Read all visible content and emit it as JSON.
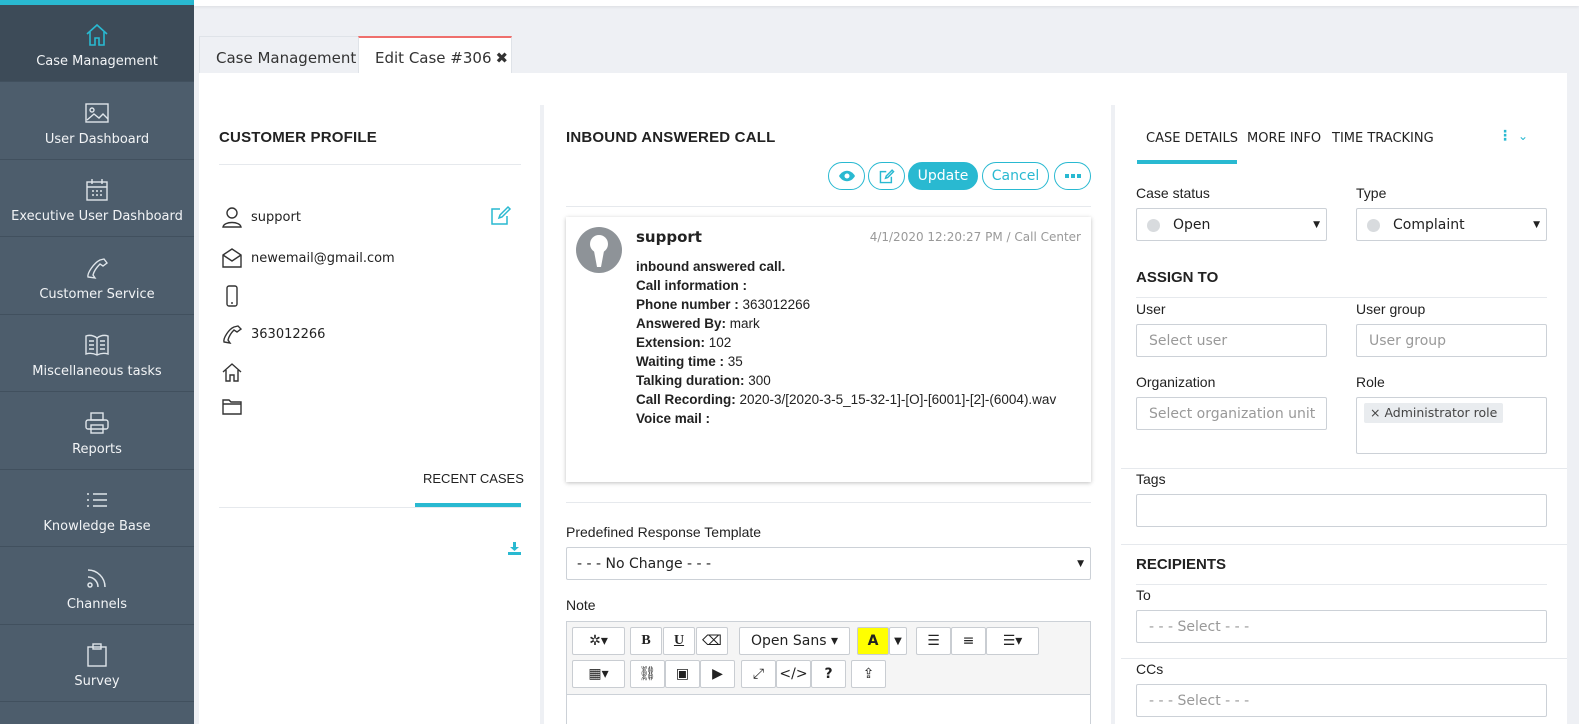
{
  "sidebar": {
    "items": [
      {
        "label": "Case Management",
        "icon": "home-icon"
      },
      {
        "label": "User Dashboard",
        "icon": "image-icon"
      },
      {
        "label": "Executive User Dashboard",
        "icon": "calendar-icon"
      },
      {
        "label": "Customer Service",
        "icon": "phone-icon"
      },
      {
        "label": "Miscellaneous tasks",
        "icon": "book-icon"
      },
      {
        "label": "Reports",
        "icon": "printer-icon"
      },
      {
        "label": "Knowledge Base",
        "icon": "list-icon"
      },
      {
        "label": "Channels",
        "icon": "rss-icon"
      },
      {
        "label": "Survey",
        "icon": "clipboard-icon"
      }
    ],
    "accent_color": "#29b9d1"
  },
  "tabs": [
    {
      "label": "Case Management"
    },
    {
      "label": "Edit Case #306",
      "close": "✖"
    }
  ],
  "profile": {
    "title": "CUSTOMER PROFILE",
    "username": "support",
    "email": "newemail@gmail.com",
    "mobile": "",
    "phone": "363012266",
    "address": "",
    "folder": "",
    "recent_cases_tab": "RECENT CASES"
  },
  "call": {
    "title": "INBOUND ANSWERED CALL",
    "buttons": {
      "update": "Update",
      "cancel": "Cancel"
    },
    "author": "support",
    "meta": "4/1/2020 12:20:27 PM / Call Center",
    "headline": "inbound answered call.",
    "info_label": "Call information :",
    "phone_label": "Phone number :",
    "phone_value": " 363012266",
    "answered_label": "Answered By:",
    "answered_value": " mark",
    "extension_label": "Extension:",
    "extension_value": " 102",
    "waiting_label": "Waiting time :",
    "waiting_value": " 35",
    "talking_label": "Talking duration:",
    "talking_value": " 300",
    "recording_label": "Call Recording:",
    "recording_value": " 2020-3/[2020-3-5_15-32-1]-[O]-[6001]-[2]-(6004).wav",
    "voicemail_label": "Voice mail :",
    "template_label": "Predefined Response Template",
    "template_value": "- - - No Change - - -",
    "note_label": "Note",
    "font_name": "Open Sans"
  },
  "details": {
    "tabs": [
      "CASE DETAILS",
      "MORE INFO",
      "TIME TRACKING"
    ],
    "status_label": "Case status",
    "status_value": "Open",
    "type_label": "Type",
    "type_value": "Complaint",
    "assign_title": "ASSIGN TO",
    "user_label": "User",
    "user_placeholder": "Select user",
    "group_label": "User group",
    "group_placeholder": "User group",
    "org_label": "Organization",
    "org_placeholder": "Select organization unit",
    "role_label": "Role",
    "role_tag": "Administrator role",
    "tags_label": "Tags",
    "recipients_title": "RECIPIENTS",
    "to_label": "To",
    "to_placeholder": "- - - Select - - -",
    "cc_label": "CCs",
    "cc_placeholder": "- - - Select - - -"
  }
}
